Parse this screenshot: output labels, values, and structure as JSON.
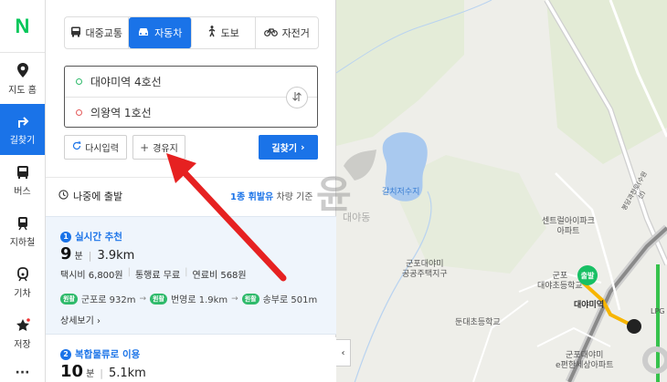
{
  "rail": {
    "logo": "N",
    "items": [
      {
        "label": "지도 홈",
        "icon": "map-pin-icon"
      },
      {
        "label": "길찾기",
        "icon": "turn-right-arrow-icon"
      },
      {
        "label": "버스",
        "icon": "bus-icon"
      },
      {
        "label": "지하철",
        "icon": "subway-icon"
      },
      {
        "label": "기차",
        "icon": "train-icon"
      },
      {
        "label": "저장",
        "icon": "star-icon"
      }
    ],
    "more": "···"
  },
  "modes": [
    {
      "label": "대중교통",
      "icon": "bus-icon"
    },
    {
      "label": "자동차",
      "icon": "car-icon"
    },
    {
      "label": "도보",
      "icon": "walk-icon"
    },
    {
      "label": "자전거",
      "icon": "bicycle-icon"
    }
  ],
  "route": {
    "origin": "대야미역 4호선",
    "destination": "의왕역 1호선"
  },
  "buttons": {
    "reset": "다시입력",
    "add_waypoint": "경유지",
    "search": "길찾기"
  },
  "options": {
    "depart_later": "나중에 출발",
    "fuel_type": "1종 휘발유",
    "fuel_suffix": "차량 기준"
  },
  "results": [
    {
      "index": "1",
      "title": "실시간 추천",
      "time_value": "9",
      "time_unit": "분",
      "distance": "3.9km",
      "taxi": "택시비 6,800원",
      "toll": "통행료 무료",
      "fuel_cost": "연료비 568원",
      "roads": [
        {
          "badge": "원활",
          "text": "군포로 932m"
        },
        {
          "badge": "원활",
          "text": "번영로 1.9km"
        },
        {
          "badge": "원활",
          "text": "송부로 501m"
        }
      ],
      "detail": "상세보기"
    },
    {
      "index": "2",
      "title": "복합물류로 이용",
      "time_value": "10",
      "time_unit": "분",
      "distance": "5.1km"
    }
  ],
  "map": {
    "labels": {
      "lake": "갈치저수지",
      "apt1": "센트럴아이파크\n아파트",
      "apt2": "군포대야미\n공공주택지구",
      "school1": "군포\n대야초등학교",
      "school2": "둔대초등학교",
      "school3": "군포대야미\ne편한세상아파트",
      "station": "대야미역",
      "highway": "봉담과천로(수원선)",
      "lpg": "LPG",
      "start_pin": "출발"
    }
  },
  "watermark": {
    "char": "윤",
    "text": "대야동"
  }
}
